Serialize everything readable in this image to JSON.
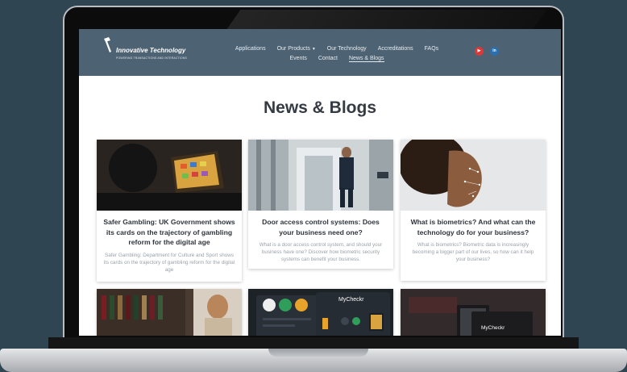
{
  "site": {
    "logo_name": "Innovative Technology",
    "logo_tagline": "POWERING TRANSACTIONS AND INTERACTIONS"
  },
  "nav": {
    "row1": [
      "Applications",
      "Our Products",
      "Our Technology",
      "Accreditations",
      "FAQs"
    ],
    "row2": [
      "Events",
      "Contact",
      "News & Blogs"
    ],
    "active": "News & Blogs"
  },
  "social": {
    "youtube_icon": "youtube-icon",
    "linkedin_label": "in"
  },
  "page": {
    "title": "News & Blogs"
  },
  "cards": [
    {
      "title": "Safer Gambling: UK Government shows its cards on the trajectory of gambling reform for the digital age",
      "excerpt": "Safer Gambling: Department for Culture and Sport shows its cards on the trajectory of gambling reform for the digital age"
    },
    {
      "title": "Door access control systems: Does your business need one?",
      "excerpt": "What is a door access control system, and should your business have one? Discover how biometric security systems can benefit your business."
    },
    {
      "title": "What is biometrics? And what can the technology do for your business?",
      "excerpt": "What is biometrics? Biometric data is increasingly becoming a bigger part of our lives, so how can it help your business?"
    }
  ],
  "row2_cards": [
    {
      "brand": ""
    },
    {
      "brand": "MyCheckr"
    },
    {
      "brand": "MyCheckr"
    }
  ],
  "colors": {
    "header": "#4d6273",
    "background": "#2f4652",
    "title": "#343b43"
  }
}
